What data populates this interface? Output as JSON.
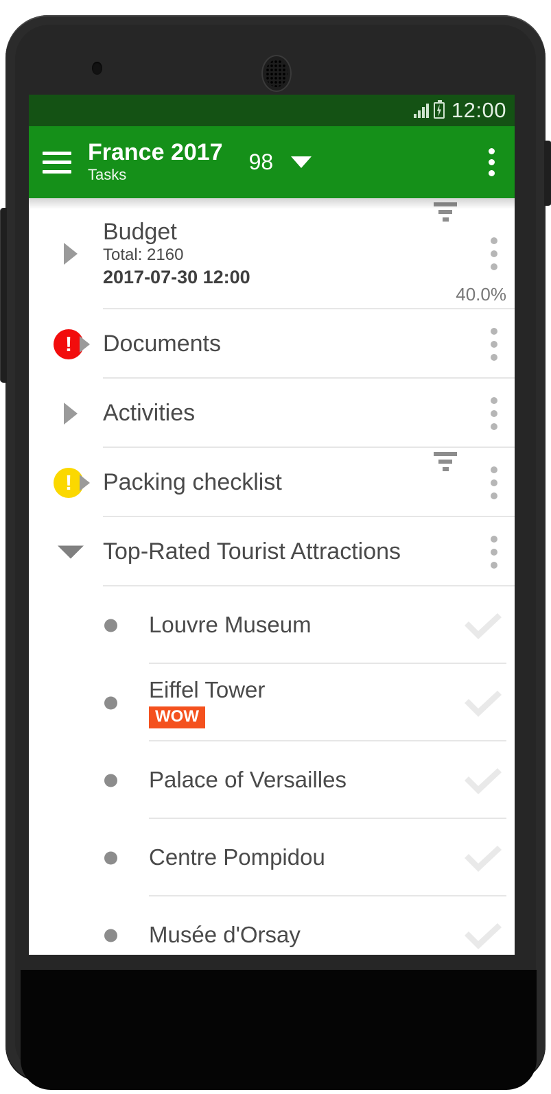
{
  "status_bar": {
    "time": "12:00",
    "signal_icon": "signal-bars-icon",
    "battery_icon": "battery-charging-icon",
    "background_color": "#145214"
  },
  "app_bar": {
    "menu_icon": "hamburger-menu-icon",
    "title": "France 2017",
    "subtitle": "Tasks",
    "task_count": "98",
    "caret_icon": "chevron-down-icon",
    "overflow_icon": "overflow-menu-icon",
    "background_color": "#159019"
  },
  "groups": [
    {
      "name": "budget",
      "title": "Budget",
      "total": "Total: 2160",
      "date": "2017-07-30 12:00",
      "percent": "40.0%",
      "expanded": false,
      "expander_icon": "caret-right-icon",
      "filter_icon": "filter-sort-icon",
      "overflow_icon": "overflow-menu-icon",
      "status_icon": null,
      "status_symbol": ""
    },
    {
      "name": "documents",
      "title": "Documents",
      "expanded": false,
      "expander_icon": "caret-right-icon",
      "status_icon": "alert-error-icon",
      "status_symbol": "!",
      "status_color": "#f20d0d",
      "overflow_icon": "overflow-menu-icon"
    },
    {
      "name": "activities",
      "title": "Activities",
      "expanded": false,
      "expander_icon": "caret-right-icon",
      "status_icon": null,
      "status_symbol": "",
      "overflow_icon": "overflow-menu-icon"
    },
    {
      "name": "packing-checklist",
      "title": "Packing checklist",
      "expanded": false,
      "expander_icon": "caret-right-icon",
      "status_icon": "alert-warning-icon",
      "status_symbol": "!",
      "status_color": "#fbd800",
      "filter_icon": "filter-sort-icon",
      "overflow_icon": "overflow-menu-icon"
    },
    {
      "name": "top-rated-tourist-attractions",
      "title": "Top-Rated Tourist Attractions",
      "expanded": true,
      "expander_icon": "caret-down-icon",
      "status_icon": null,
      "status_symbol": "",
      "overflow_icon": "overflow-menu-icon"
    }
  ],
  "sub_items": [
    {
      "name": "louvre-museum",
      "title": "Louvre Museum",
      "badge": null,
      "bullet_icon": "bullet-dot-icon",
      "check_icon": "checkmark-icon"
    },
    {
      "name": "eiffel-tower",
      "title": "Eiffel Tower",
      "badge": "WOW",
      "badge_color": "#f4511e",
      "bullet_icon": "bullet-dot-icon",
      "check_icon": "checkmark-icon"
    },
    {
      "name": "palace-of-versailles",
      "title": "Palace of Versailles",
      "badge": null,
      "bullet_icon": "bullet-dot-icon",
      "check_icon": "checkmark-icon"
    },
    {
      "name": "centre-pompidou",
      "title": "Centre Pompidou",
      "badge": null,
      "bullet_icon": "bullet-dot-icon",
      "check_icon": "checkmark-icon"
    },
    {
      "name": "musee-dorsay",
      "title": "Musée d'Orsay",
      "badge": null,
      "bullet_icon": "bullet-dot-icon",
      "check_icon": "checkmark-icon"
    }
  ],
  "fab": {
    "icon": "plus-icon",
    "color": "#1c9023"
  }
}
